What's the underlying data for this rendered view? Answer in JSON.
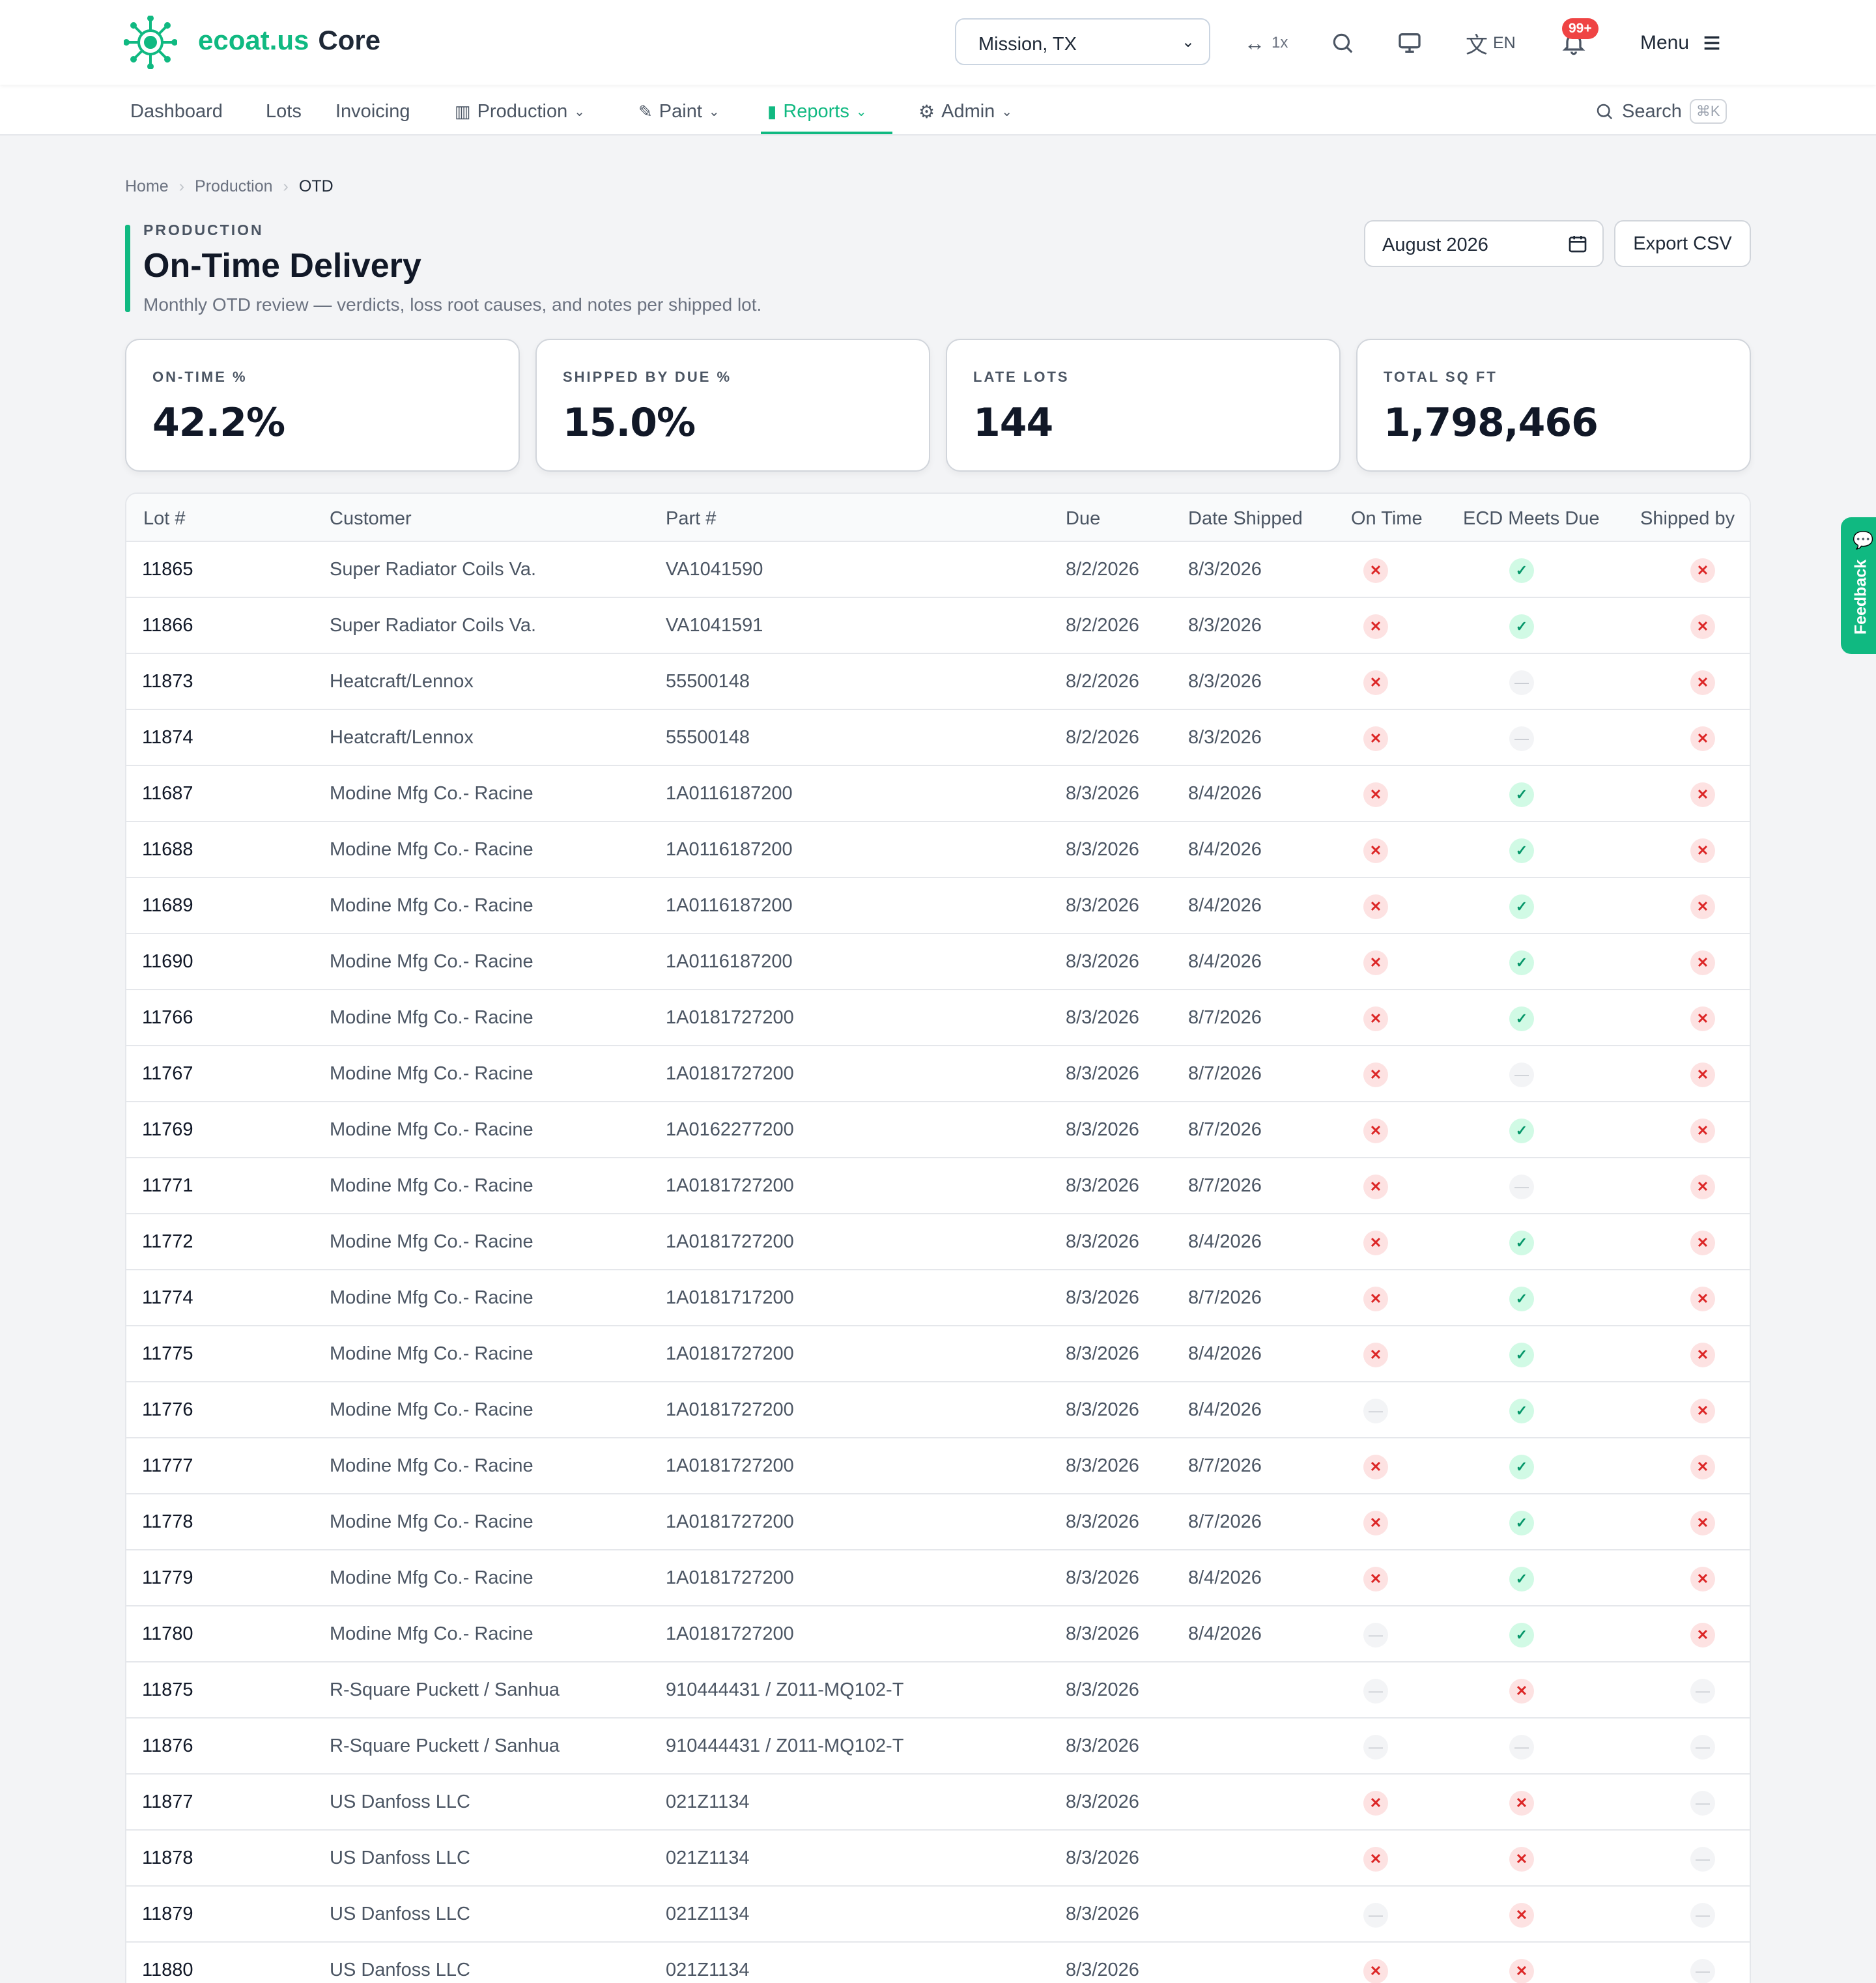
{
  "brand": {
    "name_accent": "ecoat.us",
    "name_rest": "Core",
    "logo_icon": "virus-gear-logo-icon"
  },
  "topbar": {
    "location": "Mission, TX",
    "zoom": "1x",
    "language": "EN",
    "notifications_badge": "99+",
    "menu_label": "Menu"
  },
  "nav": {
    "items": [
      "Dashboard",
      "Lots",
      "Invoicing",
      "Production",
      "Paint",
      "Reports",
      "Admin"
    ],
    "active": "Reports",
    "search_label": "Search",
    "search_shortcut": "⌘K"
  },
  "breadcrumb": [
    "Home",
    "Production",
    "OTD"
  ],
  "page": {
    "eyebrow": "PRODUCTION",
    "title": "On-Time Delivery",
    "subtitle": "Monthly OTD review — verdicts, loss root causes, and notes per shipped lot.",
    "month": "August 2026",
    "export_label": "Export CSV"
  },
  "stats": [
    {
      "label": "ON-TIME %",
      "value": "42.2%"
    },
    {
      "label": "SHIPPED BY DUE %",
      "value": "15.0%"
    },
    {
      "label": "LATE LOTS",
      "value": "144"
    },
    {
      "label": "TOTAL SQ FT",
      "value": "1,798,466"
    }
  ],
  "table": {
    "columns": [
      "Lot #",
      "Customer",
      "Part #",
      "Due",
      "Date Shipped",
      "On Time",
      "ECD Meets Due",
      "Shipped by"
    ],
    "rows": [
      {
        "lot": "11865",
        "customer": "Super Radiator Coils Va.",
        "part": "VA1041590",
        "due": "8/2/2026",
        "shipped": "8/3/2026",
        "on_time": "x",
        "ecd": "check",
        "shipped_by": "x"
      },
      {
        "lot": "11866",
        "customer": "Super Radiator Coils Va.",
        "part": "VA1041591",
        "due": "8/2/2026",
        "shipped": "8/3/2026",
        "on_time": "x",
        "ecd": "check",
        "shipped_by": "x"
      },
      {
        "lot": "11873",
        "customer": "Heatcraft/Lennox",
        "part": "55500148",
        "due": "8/2/2026",
        "shipped": "8/3/2026",
        "on_time": "x",
        "ecd": "none",
        "shipped_by": "x"
      },
      {
        "lot": "11874",
        "customer": "Heatcraft/Lennox",
        "part": "55500148",
        "due": "8/2/2026",
        "shipped": "8/3/2026",
        "on_time": "x",
        "ecd": "none",
        "shipped_by": "x"
      },
      {
        "lot": "11687",
        "customer": "Modine Mfg Co.- Racine",
        "part": "1A0116187200",
        "due": "8/3/2026",
        "shipped": "8/4/2026",
        "on_time": "x",
        "ecd": "check",
        "shipped_by": "x"
      },
      {
        "lot": "11688",
        "customer": "Modine Mfg Co.- Racine",
        "part": "1A0116187200",
        "due": "8/3/2026",
        "shipped": "8/4/2026",
        "on_time": "x",
        "ecd": "check",
        "shipped_by": "x"
      },
      {
        "lot": "11689",
        "customer": "Modine Mfg Co.- Racine",
        "part": "1A0116187200",
        "due": "8/3/2026",
        "shipped": "8/4/2026",
        "on_time": "x",
        "ecd": "check",
        "shipped_by": "x"
      },
      {
        "lot": "11690",
        "customer": "Modine Mfg Co.- Racine",
        "part": "1A0116187200",
        "due": "8/3/2026",
        "shipped": "8/4/2026",
        "on_time": "x",
        "ecd": "check",
        "shipped_by": "x"
      },
      {
        "lot": "11766",
        "customer": "Modine Mfg Co.- Racine",
        "part": "1A0181727200",
        "due": "8/3/2026",
        "shipped": "8/7/2026",
        "on_time": "x",
        "ecd": "check",
        "shipped_by": "x"
      },
      {
        "lot": "11767",
        "customer": "Modine Mfg Co.- Racine",
        "part": "1A0181727200",
        "due": "8/3/2026",
        "shipped": "8/7/2026",
        "on_time": "x",
        "ecd": "none",
        "shipped_by": "x"
      },
      {
        "lot": "11769",
        "customer": "Modine Mfg Co.- Racine",
        "part": "1A0162277200",
        "due": "8/3/2026",
        "shipped": "8/7/2026",
        "on_time": "x",
        "ecd": "check",
        "shipped_by": "x"
      },
      {
        "lot": "11771",
        "customer": "Modine Mfg Co.- Racine",
        "part": "1A0181727200",
        "due": "8/3/2026",
        "shipped": "8/7/2026",
        "on_time": "x",
        "ecd": "none",
        "shipped_by": "x"
      },
      {
        "lot": "11772",
        "customer": "Modine Mfg Co.- Racine",
        "part": "1A0181727200",
        "due": "8/3/2026",
        "shipped": "8/4/2026",
        "on_time": "x",
        "ecd": "check",
        "shipped_by": "x"
      },
      {
        "lot": "11774",
        "customer": "Modine Mfg Co.- Racine",
        "part": "1A0181717200",
        "due": "8/3/2026",
        "shipped": "8/7/2026",
        "on_time": "x",
        "ecd": "check",
        "shipped_by": "x"
      },
      {
        "lot": "11775",
        "customer": "Modine Mfg Co.- Racine",
        "part": "1A0181727200",
        "due": "8/3/2026",
        "shipped": "8/4/2026",
        "on_time": "x",
        "ecd": "check",
        "shipped_by": "x"
      },
      {
        "lot": "11776",
        "customer": "Modine Mfg Co.- Racine",
        "part": "1A0181727200",
        "due": "8/3/2026",
        "shipped": "8/4/2026",
        "on_time": "none",
        "ecd": "check",
        "shipped_by": "x"
      },
      {
        "lot": "11777",
        "customer": "Modine Mfg Co.- Racine",
        "part": "1A0181727200",
        "due": "8/3/2026",
        "shipped": "8/7/2026",
        "on_time": "x",
        "ecd": "check",
        "shipped_by": "x"
      },
      {
        "lot": "11778",
        "customer": "Modine Mfg Co.- Racine",
        "part": "1A0181727200",
        "due": "8/3/2026",
        "shipped": "8/7/2026",
        "on_time": "x",
        "ecd": "check",
        "shipped_by": "x"
      },
      {
        "lot": "11779",
        "customer": "Modine Mfg Co.- Racine",
        "part": "1A0181727200",
        "due": "8/3/2026",
        "shipped": "8/4/2026",
        "on_time": "x",
        "ecd": "check",
        "shipped_by": "x"
      },
      {
        "lot": "11780",
        "customer": "Modine Mfg Co.- Racine",
        "part": "1A0181727200",
        "due": "8/3/2026",
        "shipped": "8/4/2026",
        "on_time": "none",
        "ecd": "check",
        "shipped_by": "x"
      },
      {
        "lot": "11875",
        "customer": "R-Square Puckett / Sanhua",
        "part": "910444431 / Z011-MQ102-T",
        "due": "8/3/2026",
        "shipped": "",
        "on_time": "none",
        "ecd": "x",
        "shipped_by": "none"
      },
      {
        "lot": "11876",
        "customer": "R-Square Puckett / Sanhua",
        "part": "910444431 / Z011-MQ102-T",
        "due": "8/3/2026",
        "shipped": "",
        "on_time": "none",
        "ecd": "none",
        "shipped_by": "none"
      },
      {
        "lot": "11877",
        "customer": "US Danfoss LLC",
        "part": "021Z1134",
        "due": "8/3/2026",
        "shipped": "",
        "on_time": "x",
        "ecd": "x",
        "shipped_by": "none"
      },
      {
        "lot": "11878",
        "customer": "US Danfoss LLC",
        "part": "021Z1134",
        "due": "8/3/2026",
        "shipped": "",
        "on_time": "x",
        "ecd": "x",
        "shipped_by": "none"
      },
      {
        "lot": "11879",
        "customer": "US Danfoss LLC",
        "part": "021Z1134",
        "due": "8/3/2026",
        "shipped": "",
        "on_time": "none",
        "ecd": "x",
        "shipped_by": "none"
      },
      {
        "lot": "11880",
        "customer": "US Danfoss LLC",
        "part": "021Z1134",
        "due": "8/3/2026",
        "shipped": "",
        "on_time": "x",
        "ecd": "x",
        "shipped_by": "none"
      }
    ]
  },
  "feedback": {
    "label": "Feedback",
    "icon": "chat-bubble-icon"
  },
  "colors": {
    "accent": "#10b981",
    "danger": "#dc2626",
    "success": "#059669"
  }
}
